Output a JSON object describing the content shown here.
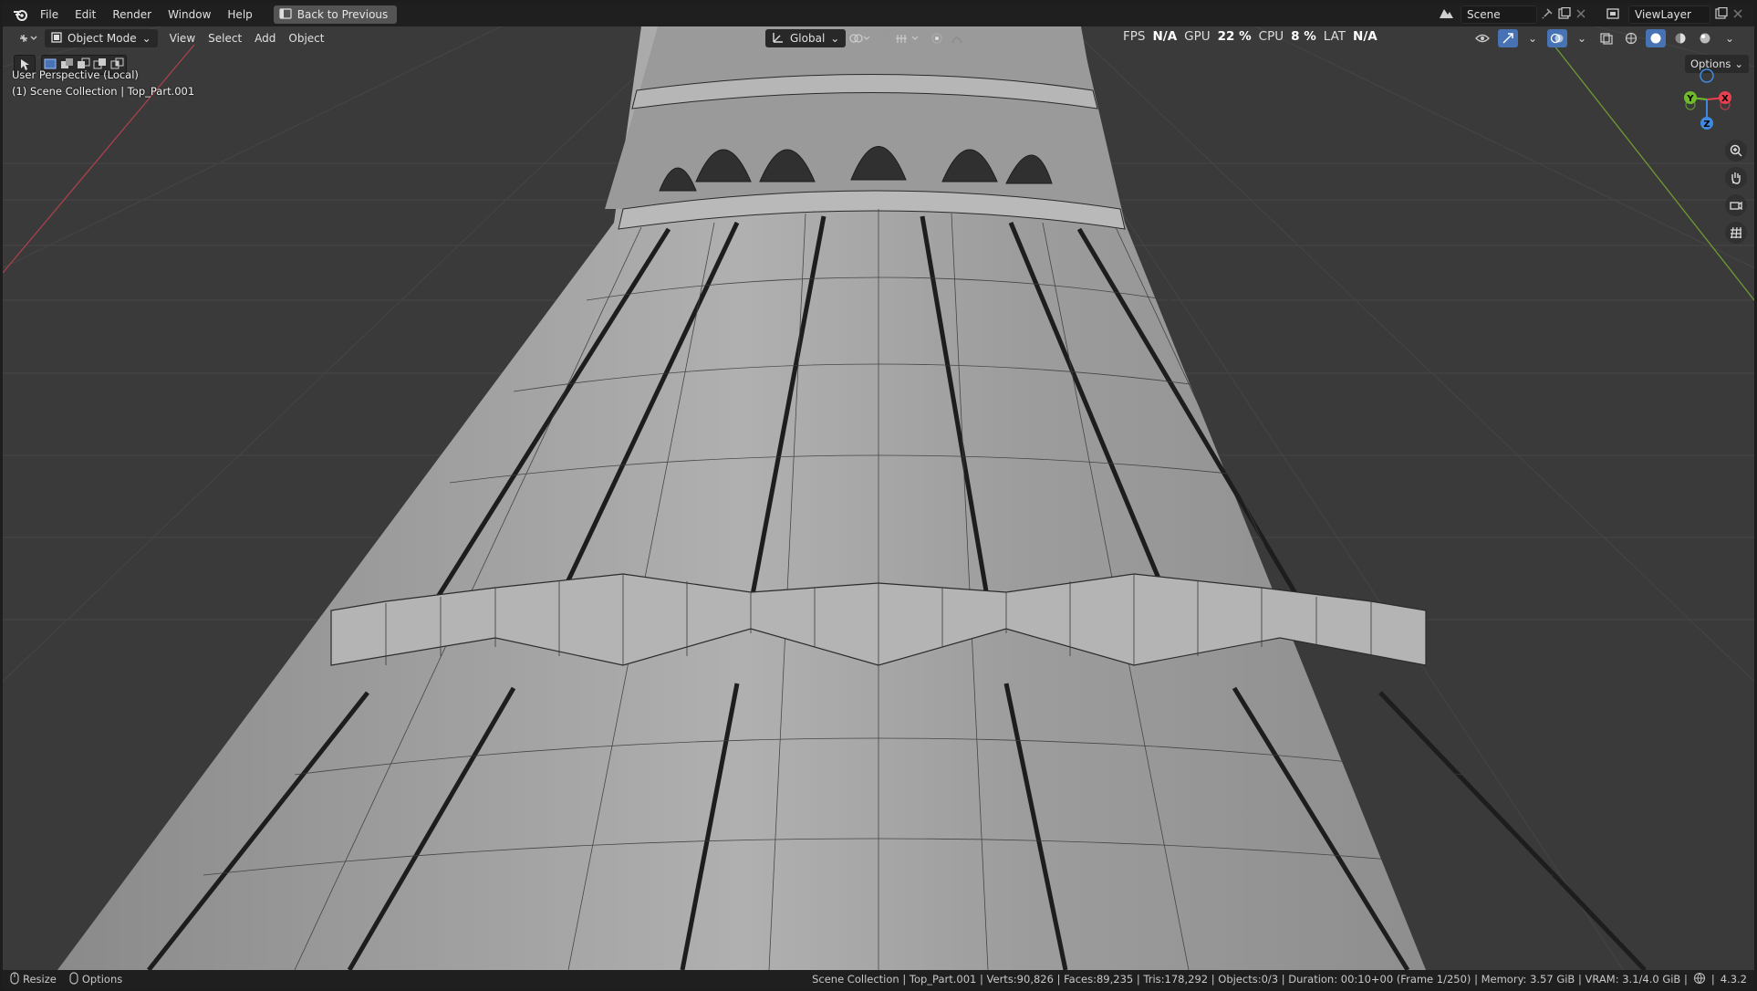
{
  "menubar": {
    "items": [
      "File",
      "Edit",
      "Render",
      "Window",
      "Help"
    ],
    "back_button": "Back to Previous",
    "scene_label": "Scene",
    "view_layer_label": "ViewLayer"
  },
  "viewport_header": {
    "mode": "Object Mode",
    "menus": [
      "View",
      "Select",
      "Add",
      "Object"
    ],
    "transform_orientation": "Global",
    "options_label": "Options"
  },
  "performance": {
    "fps_label": "FPS",
    "fps_value": "N/A",
    "gpu_label": "GPU",
    "gpu_value": "22 %",
    "cpu_label": "CPU",
    "cpu_value": "8 %",
    "lat_label": "LAT",
    "lat_value": "N/A"
  },
  "viewport_info": {
    "view_name": "User Perspective (Local)",
    "collection_line": "(1) Scene Collection | Top_Part.001"
  },
  "gizmo": {
    "x": "X",
    "y": "Y",
    "z": "Z",
    "x_color": "#e8404e",
    "y_color": "#70bb2c",
    "z_color": "#3d8ae0"
  },
  "statusbar": {
    "resize_label": "Resize",
    "options_label": "Options",
    "stats": "Scene Collection | Top_Part.001 | Verts:90,826 | Faces:89,235 | Tris:178,292 | Objects:0/3 | Duration: 00:10+00 (Frame 1/250) | Memory: 3.57 GiB | VRAM: 3.1/4.0 GiB |",
    "version": "4.3.2"
  },
  "icons": [
    "blender-logo-icon",
    "back-icon",
    "editor-type-icon",
    "object-mode-icon",
    "orientation-icon",
    "pivot-icon",
    "snap-icon",
    "proportional-icon",
    "visibility-icon",
    "gizmo-icon",
    "overlay-icon",
    "xray-icon",
    "shading-solid-icon",
    "zoom-icon",
    "pan-icon",
    "camera-icon",
    "grid-icon"
  ]
}
